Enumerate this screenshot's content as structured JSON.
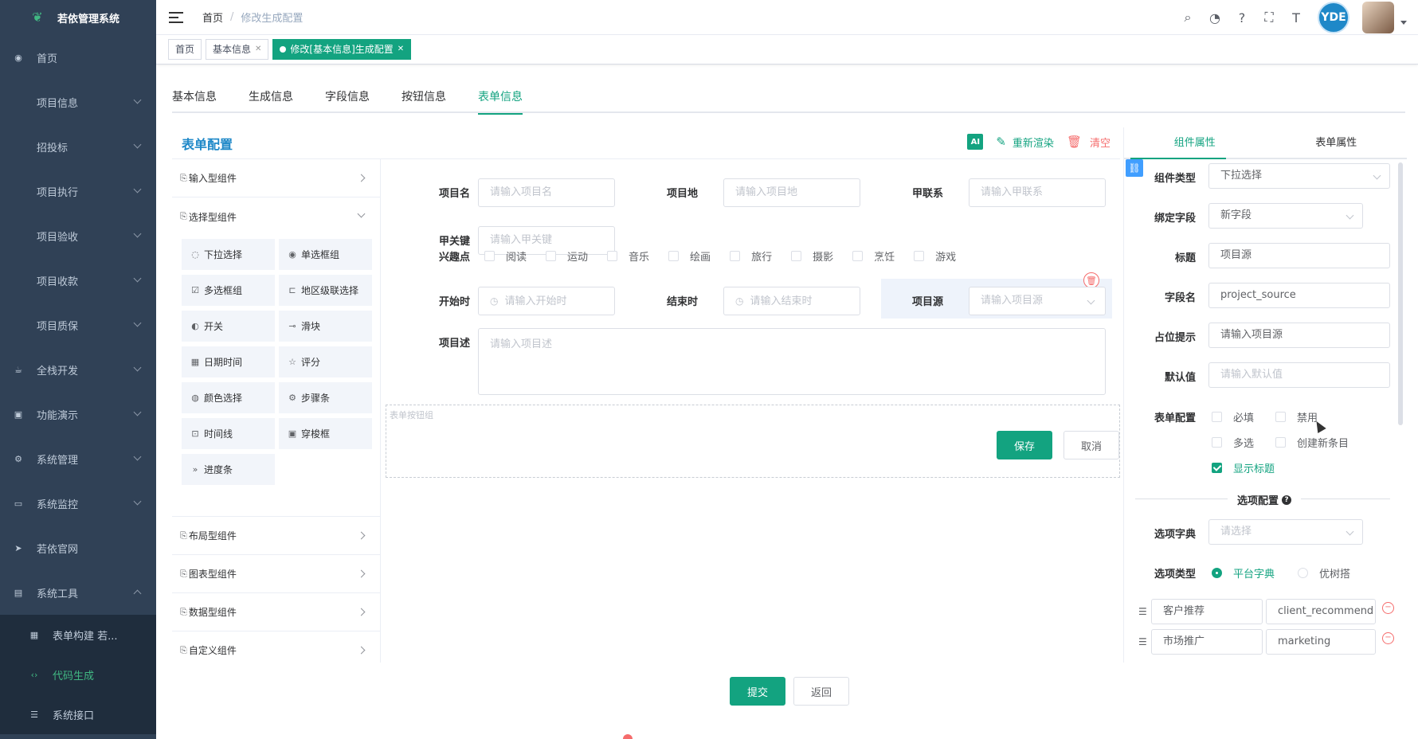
{
  "app": {
    "title": "若依管理系统"
  },
  "sidebar": {
    "items": [
      {
        "label": "首页",
        "icon": "dashboard-icon",
        "has_children": false
      },
      {
        "label": "项目信息",
        "icon": "",
        "has_children": true
      },
      {
        "label": "招投标",
        "icon": "",
        "has_children": true
      },
      {
        "label": "项目执行",
        "icon": "",
        "has_children": true
      },
      {
        "label": "项目验收",
        "icon": "",
        "has_children": true
      },
      {
        "label": "项目收款",
        "icon": "",
        "has_children": true
      },
      {
        "label": "项目质保",
        "icon": "",
        "has_children": true
      },
      {
        "label": "全栈开发",
        "icon": "cup-icon",
        "has_children": true
      },
      {
        "label": "功能演示",
        "icon": "bookmark-icon",
        "has_children": true
      },
      {
        "label": "系统管理",
        "icon": "gear-icon",
        "has_children": true
      },
      {
        "label": "系统监控",
        "icon": "monitor-icon",
        "has_children": true
      },
      {
        "label": "若依官网",
        "icon": "send-icon",
        "has_children": false
      },
      {
        "label": "系统工具",
        "icon": "toolbox-icon",
        "has_children": true,
        "expanded": true
      }
    ],
    "sub_items": [
      {
        "label": "表单构建 若...",
        "icon": "grid-icon",
        "active": false
      },
      {
        "label": "代码生成",
        "icon": "code-icon",
        "active": true
      },
      {
        "label": "系统接口",
        "icon": "sliders-icon",
        "active": false
      }
    ]
  },
  "navbar": {
    "breadcrumb": [
      "首页",
      "修改生成配置"
    ],
    "avatar_text": "YDE"
  },
  "tags": [
    {
      "label": "首页",
      "active": false,
      "closable": false
    },
    {
      "label": "基本信息",
      "active": false,
      "closable": true
    },
    {
      "label": "修改[基本信息]生成配置",
      "active": true,
      "closable": true
    }
  ],
  "main_tabs": [
    "基本信息",
    "生成信息",
    "字段信息",
    "按钮信息",
    "表单信息"
  ],
  "main_tabs_active": 4,
  "form_builder": {
    "title": "表单配置",
    "ai_label": "AI",
    "rerender_label": "重新渲染",
    "clear_label": "清空"
  },
  "palette": {
    "groups": {
      "input": "输入型组件",
      "select": "选择型组件",
      "layout": "布局型组件",
      "chart": "图表型组件",
      "data": "数据型组件",
      "custom": "自定义组件"
    },
    "select_components": [
      {
        "label": "下拉选择",
        "icon": "select-icon"
      },
      {
        "label": "单选框组",
        "icon": "radio-icon"
      },
      {
        "label": "多选框组",
        "icon": "checkbox-icon"
      },
      {
        "label": "地区级联选择",
        "icon": "cascader-icon"
      },
      {
        "label": "开关",
        "icon": "switch-icon"
      },
      {
        "label": "滑块",
        "icon": "slider-icon"
      },
      {
        "label": "日期时间",
        "icon": "calendar-icon"
      },
      {
        "label": "评分",
        "icon": "star-icon"
      },
      {
        "label": "颜色选择",
        "icon": "palette-icon"
      },
      {
        "label": "步骤条",
        "icon": "steps-icon"
      },
      {
        "label": "时间线",
        "icon": "timeline-icon"
      },
      {
        "label": "穿梭框",
        "icon": "transfer-icon"
      },
      {
        "label": "进度条",
        "icon": "progress-icon"
      }
    ]
  },
  "canvas": {
    "fields": {
      "name": {
        "label": "项目名",
        "placeholder": "请输入项目名"
      },
      "place": {
        "label": "项目地",
        "placeholder": "请输入项目地"
      },
      "contact": {
        "label": "甲联系",
        "placeholder": "请输入甲联系"
      },
      "key": {
        "label": "甲关键",
        "placeholder": "请输入甲关键"
      },
      "interest": {
        "label": "兴趣点",
        "options": [
          "阅读",
          "运动",
          "音乐",
          "绘画",
          "旅行",
          "摄影",
          "烹饪",
          "游戏"
        ]
      },
      "start": {
        "label": "开始时",
        "placeholder": "请输入开始时"
      },
      "end": {
        "label": "结束时",
        "placeholder": "请输入结束时"
      },
      "source": {
        "label": "项目源",
        "placeholder": "请输入项目源"
      },
      "desc": {
        "label": "项目述",
        "placeholder": "请输入项目述"
      }
    },
    "button_group_label": "表单按钮组",
    "save_label": "保存",
    "cancel_label": "取消"
  },
  "props": {
    "tab_component": "组件属性",
    "tab_form": "表单属性",
    "component_type": {
      "label": "组件类型",
      "value": "下拉选择"
    },
    "bind_field": {
      "label": "绑定字段",
      "value": "新字段"
    },
    "title": {
      "label": "标题",
      "value": "项目源"
    },
    "field_name": {
      "label": "字段名",
      "value": "project_source"
    },
    "placeholder": {
      "label": "占位提示",
      "value": "请输入项目源"
    },
    "default_value": {
      "label": "默认值",
      "placeholder": "请输入默认值"
    },
    "form_config": {
      "label": "表单配置",
      "required": "必填",
      "disabled": "禁用",
      "multiple": "多选",
      "create_new": "创建新条目",
      "show_label": "显示标题"
    },
    "options_divider": "选项配置",
    "options_dict": {
      "label": "选项字典",
      "placeholder": "请选择"
    },
    "options_type": {
      "label": "选项类型",
      "platform": "平台字典",
      "youshu": "优树搭"
    },
    "options": [
      {
        "label": "客户推荐",
        "value": "client_recommend"
      },
      {
        "label": "市场推广",
        "value": "marketing"
      }
    ]
  },
  "footer": {
    "submit_label": "提交",
    "back_label": "返回"
  },
  "colors": {
    "accent": "#13a380",
    "sidebar_bg": "#304156",
    "title_blue": "#1e88c8",
    "danger": "#f56c6c"
  }
}
